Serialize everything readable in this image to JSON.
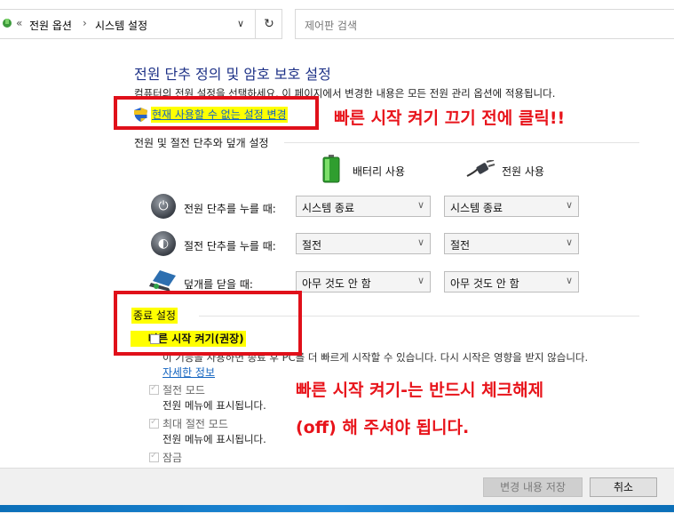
{
  "address_bar": {
    "crumb_prefix": "«",
    "crumb_1": "전원 옵션",
    "separator": "›",
    "crumb_2": "시스템 설정",
    "dropdown_glyph": "∨",
    "refresh_glyph": "↻"
  },
  "search": {
    "placeholder": "제어판 검색"
  },
  "page": {
    "title": "전원 단추 정의 및 암호 보호 설정",
    "description": "컴퓨터의 전원 설정을 선택하세요. 이 페이지에서 변경한 내용은 모든 전원 관리 옵션에 적용됩니다.",
    "change_settings_link": "현재 사용할 수 없는 설정 변경",
    "section_buttons": "전원 및 절전 단추와 덮개 설정"
  },
  "columns": {
    "battery": "배터리 사용",
    "plugged": "전원 사용"
  },
  "rows": [
    {
      "label": "전원 단추를 누를 때:",
      "battery_value": "시스템 종료",
      "plugged_value": "시스템 종료"
    },
    {
      "label": "절전 단추를 누를 때:",
      "battery_value": "절전",
      "plugged_value": "절전"
    },
    {
      "label": "덮개를 닫을 때:",
      "battery_value": "아무 것도 안 함",
      "plugged_value": "아무 것도 안 함"
    }
  ],
  "shutdown": {
    "heading": "종료 설정",
    "fast_startup": "빠른 시작 켜기(권장)",
    "fast_startup_desc": "이 기능을 사용하면 종료 후 PC를 더 빠르게 시작할 수 있습니다. 다시 시작은 영향을 받지 않습니다.",
    "learn_more": "자세한 정보",
    "sleep": "절전 모드",
    "sleep_desc": "전원 메뉴에 표시됩니다.",
    "hibernate": "최대 절전 모드",
    "hibernate_desc": "전원 메뉴에 표시됩니다.",
    "lock": "잠금"
  },
  "callouts": {
    "top": "빠른 시작 켜기 끄기 전에 클릭!!",
    "bottom_line1": "빠른 시작 켜기-는 반드시 체크해제",
    "bottom_line2": "(off) 해 주셔야 됩니다."
  },
  "buttons": {
    "save": "변경 내용 저장",
    "cancel": "취소"
  },
  "colors": {
    "annotation_red": "#e8141b",
    "highlight_yellow": "#ffff00",
    "title_blue": "#1e3287",
    "link_blue": "#1565c0"
  }
}
